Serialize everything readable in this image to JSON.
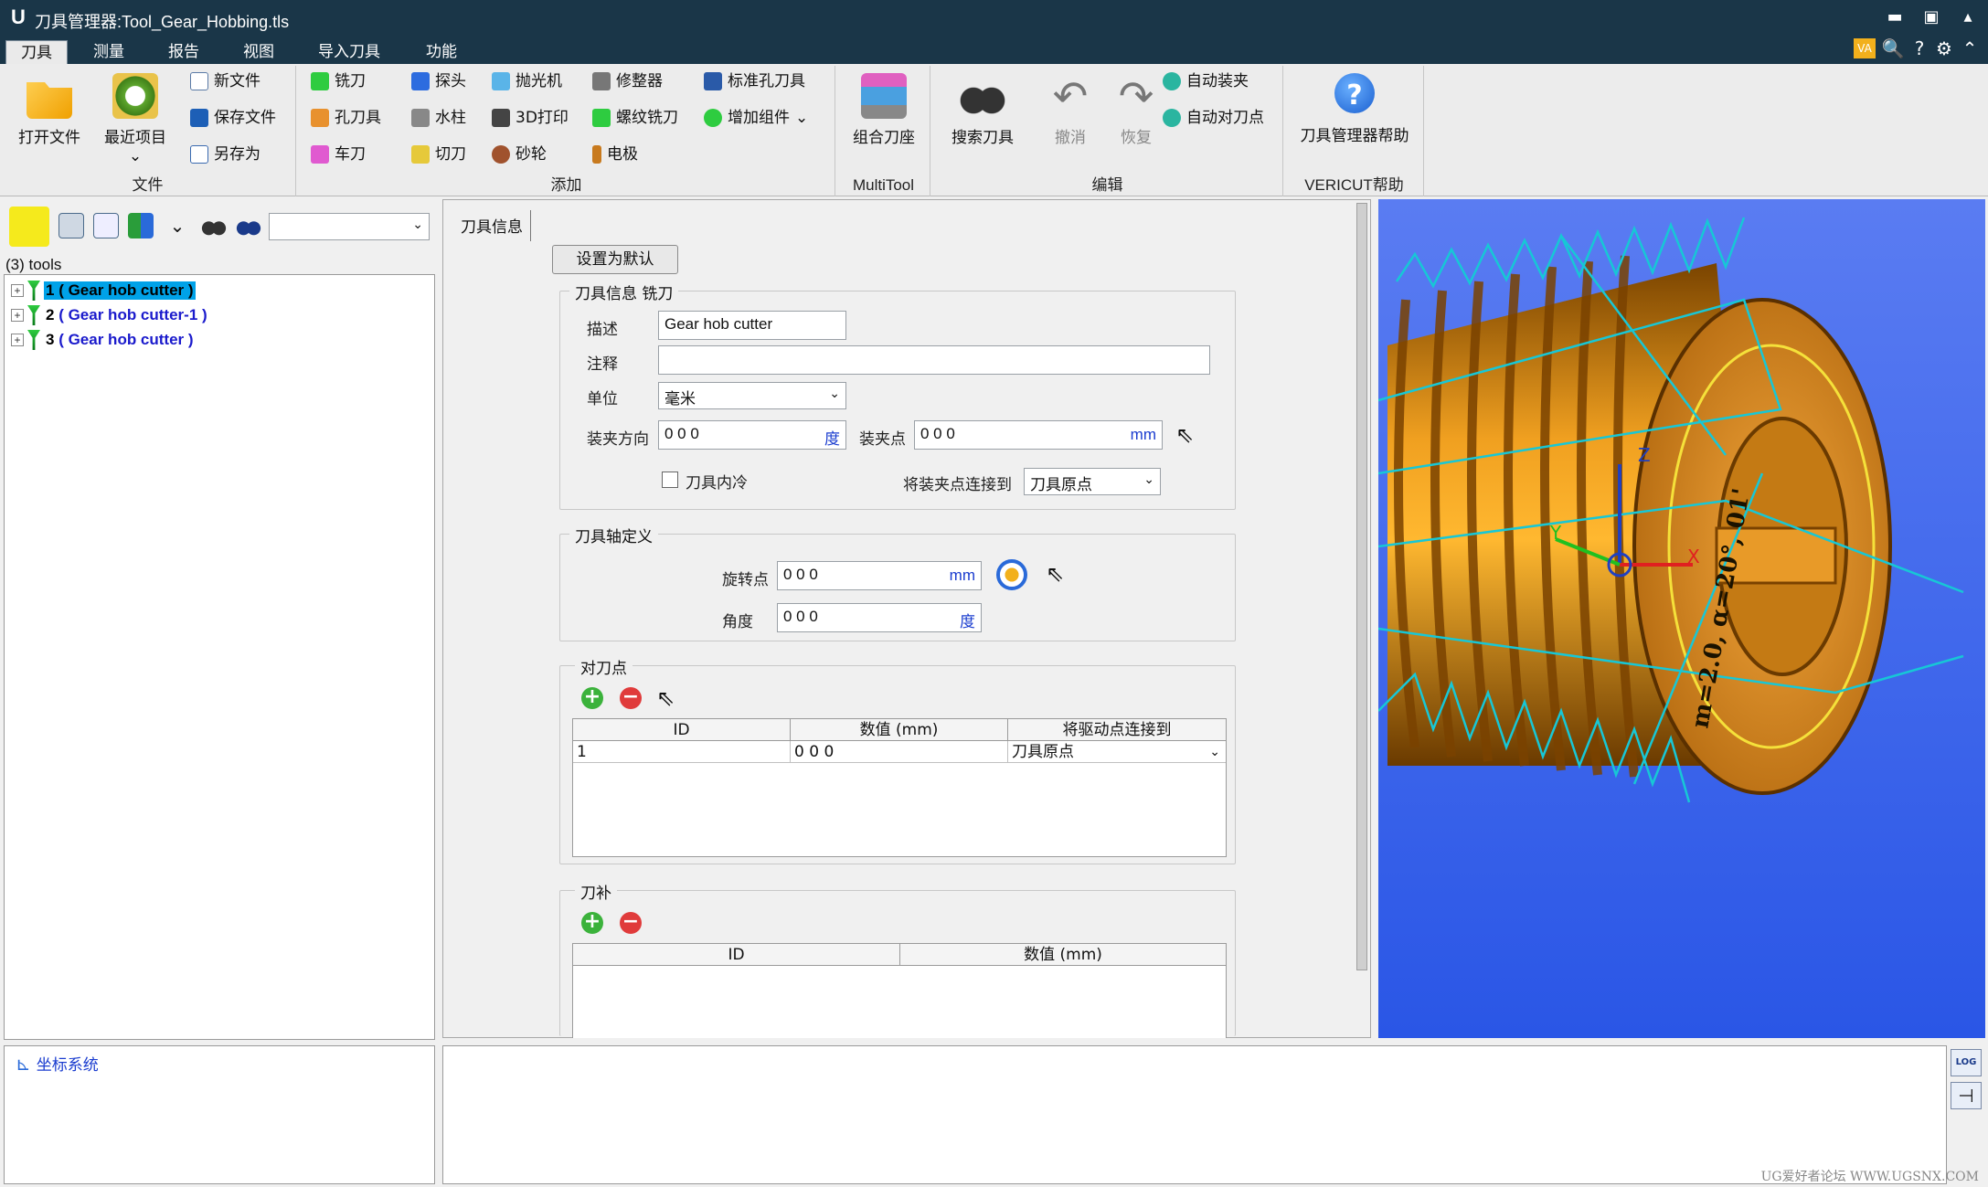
{
  "window": {
    "logo": "U",
    "title": "刀具管理器:Tool_Gear_Hobbing.tls",
    "controls": [
      "▬",
      "▣",
      "▴"
    ]
  },
  "menu": {
    "tabs": [
      "刀具",
      "测量",
      "报告",
      "视图",
      "导入刀具",
      "功能"
    ],
    "active": "刀具",
    "right_icons": [
      "VA",
      "🔍",
      "?",
      "⚙",
      "⌃"
    ]
  },
  "ribbon": {
    "file": {
      "open": "打开文件",
      "recent": "最近项目",
      "recent_arrow": "⌄",
      "new": "新文件",
      "save": "保存文件",
      "saveas": "另存为",
      "group": "文件"
    },
    "add": {
      "group": "添加",
      "items": [
        "铣刀",
        "探头",
        "抛光机",
        "修整器",
        "标准孔刀具",
        "孔刀具",
        "水柱",
        "3D打印",
        "螺纹铣刀",
        "增加组件",
        "车刀",
        "切刀",
        "砂轮",
        "电极"
      ],
      "more_arrow": "⌄"
    },
    "multitool": {
      "label": "组合刀座",
      "group": "MultiTool"
    },
    "edit": {
      "search": "搜索刀具",
      "undo": "撤消",
      "redo": "恢复",
      "auto_load": "自动装夹",
      "auto_tool": "自动对刀点",
      "group": "编辑"
    },
    "help": {
      "label": "刀具管理器帮助",
      "group": "VERICUT帮助"
    }
  },
  "left": {
    "count": "(3) tools",
    "tools": [
      {
        "num": "1",
        "label": "( Gear hob cutter )",
        "selected": true
      },
      {
        "num": "2",
        "label": "( Gear hob cutter-1 )",
        "selected": false
      },
      {
        "num": "3",
        "label": "( Gear hob cutter )",
        "selected": false
      }
    ],
    "coord": "坐标系统",
    "combo_arrow": "⌄"
  },
  "form": {
    "tab": "刀具信息",
    "set_default": "设置为默认",
    "info": {
      "legend": "刀具信息 铣刀",
      "desc_label": "描述",
      "desc_value": "Gear hob cutter",
      "note_label": "注释",
      "note_value": "",
      "unit_label": "单位",
      "unit_value": "毫米",
      "dir_label": "装夹方向",
      "dir_value": "0 0 0",
      "dir_unit": "度",
      "clamp_label": "装夹点",
      "clamp_value": "0 0 0",
      "clamp_unit": "mm",
      "coolant_label": "刀具内冷",
      "connect_label": "将装夹点连接到",
      "connect_value": "刀具原点"
    },
    "axis": {
      "legend": "刀具轴定义",
      "rot_label": "旋转点",
      "rot_value": "0 0 0",
      "rot_unit": "mm",
      "angle_label": "角度",
      "angle_value": "0 0 0",
      "angle_unit": "度"
    },
    "gauge": {
      "legend": "对刀点",
      "headers": [
        "ID",
        "数值 (mm)",
        "将驱动点连接到"
      ],
      "rows": [
        {
          "id": "1",
          "value": "0 0 0",
          "connect": "刀具原点"
        }
      ]
    },
    "comp": {
      "legend": "刀补",
      "headers": [
        "ID",
        "数值 (mm)"
      ]
    }
  },
  "view3d": {
    "axis_z": "Z",
    "axis_y": "Y",
    "axis_x": "X",
    "engraving": "m=2.0, α=20°, 01'"
  },
  "bottom_icons": [
    "LOG",
    "⊣"
  ],
  "watermark": "UG爱好者论坛 WWW.UGSNX.COM",
  "colors": {
    "titlebar": "#1a3648",
    "accent": "#00a2e8",
    "viewport": "#2a56e6",
    "part": "#e58a0e"
  }
}
